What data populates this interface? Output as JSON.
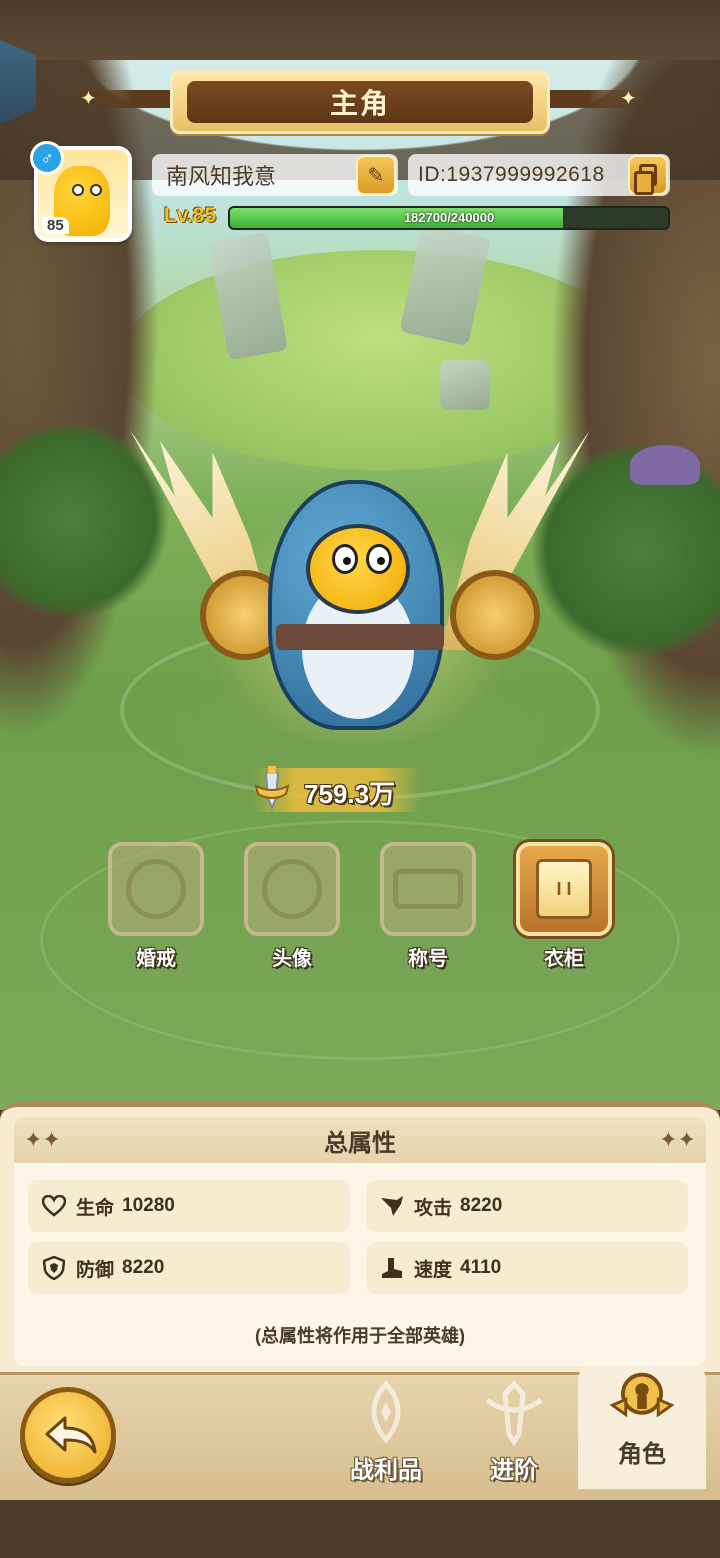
{
  "header": {
    "title": "主角"
  },
  "player": {
    "name": "南风知我意",
    "id_label": "ID:1937999992618",
    "avatar_level": "85",
    "gender_symbol": "♂",
    "level_label": "Lv.85",
    "xp_text": "182700/240000",
    "xp_fraction": 0.761
  },
  "power": {
    "value": "759.3万"
  },
  "features": [
    {
      "label": "婚戒",
      "active": false
    },
    {
      "label": "头像",
      "active": false
    },
    {
      "label": "称号",
      "active": false
    },
    {
      "label": "衣柜",
      "active": true
    }
  ],
  "wardrobe_icon_text": "I I",
  "attributes": {
    "title": "总属性",
    "items": [
      {
        "label": "生命",
        "value": "10280",
        "icon": "heart-icon"
      },
      {
        "label": "攻击",
        "value": "8220",
        "icon": "attack-icon"
      },
      {
        "label": "防御",
        "value": "8220",
        "icon": "shield-icon"
      },
      {
        "label": "速度",
        "value": "4110",
        "icon": "boot-icon"
      }
    ],
    "note": "(总属性将作用于全部英雄)"
  },
  "bottom_nav": {
    "items": [
      {
        "label": "战利品",
        "active": false
      },
      {
        "label": "进阶",
        "active": false
      },
      {
        "label": "角色",
        "active": true
      }
    ]
  },
  "colors": {
    "accent_gold": "#e9a81c",
    "xp_green": "#3fae3a",
    "panel_bg": "#fbf6e8"
  }
}
